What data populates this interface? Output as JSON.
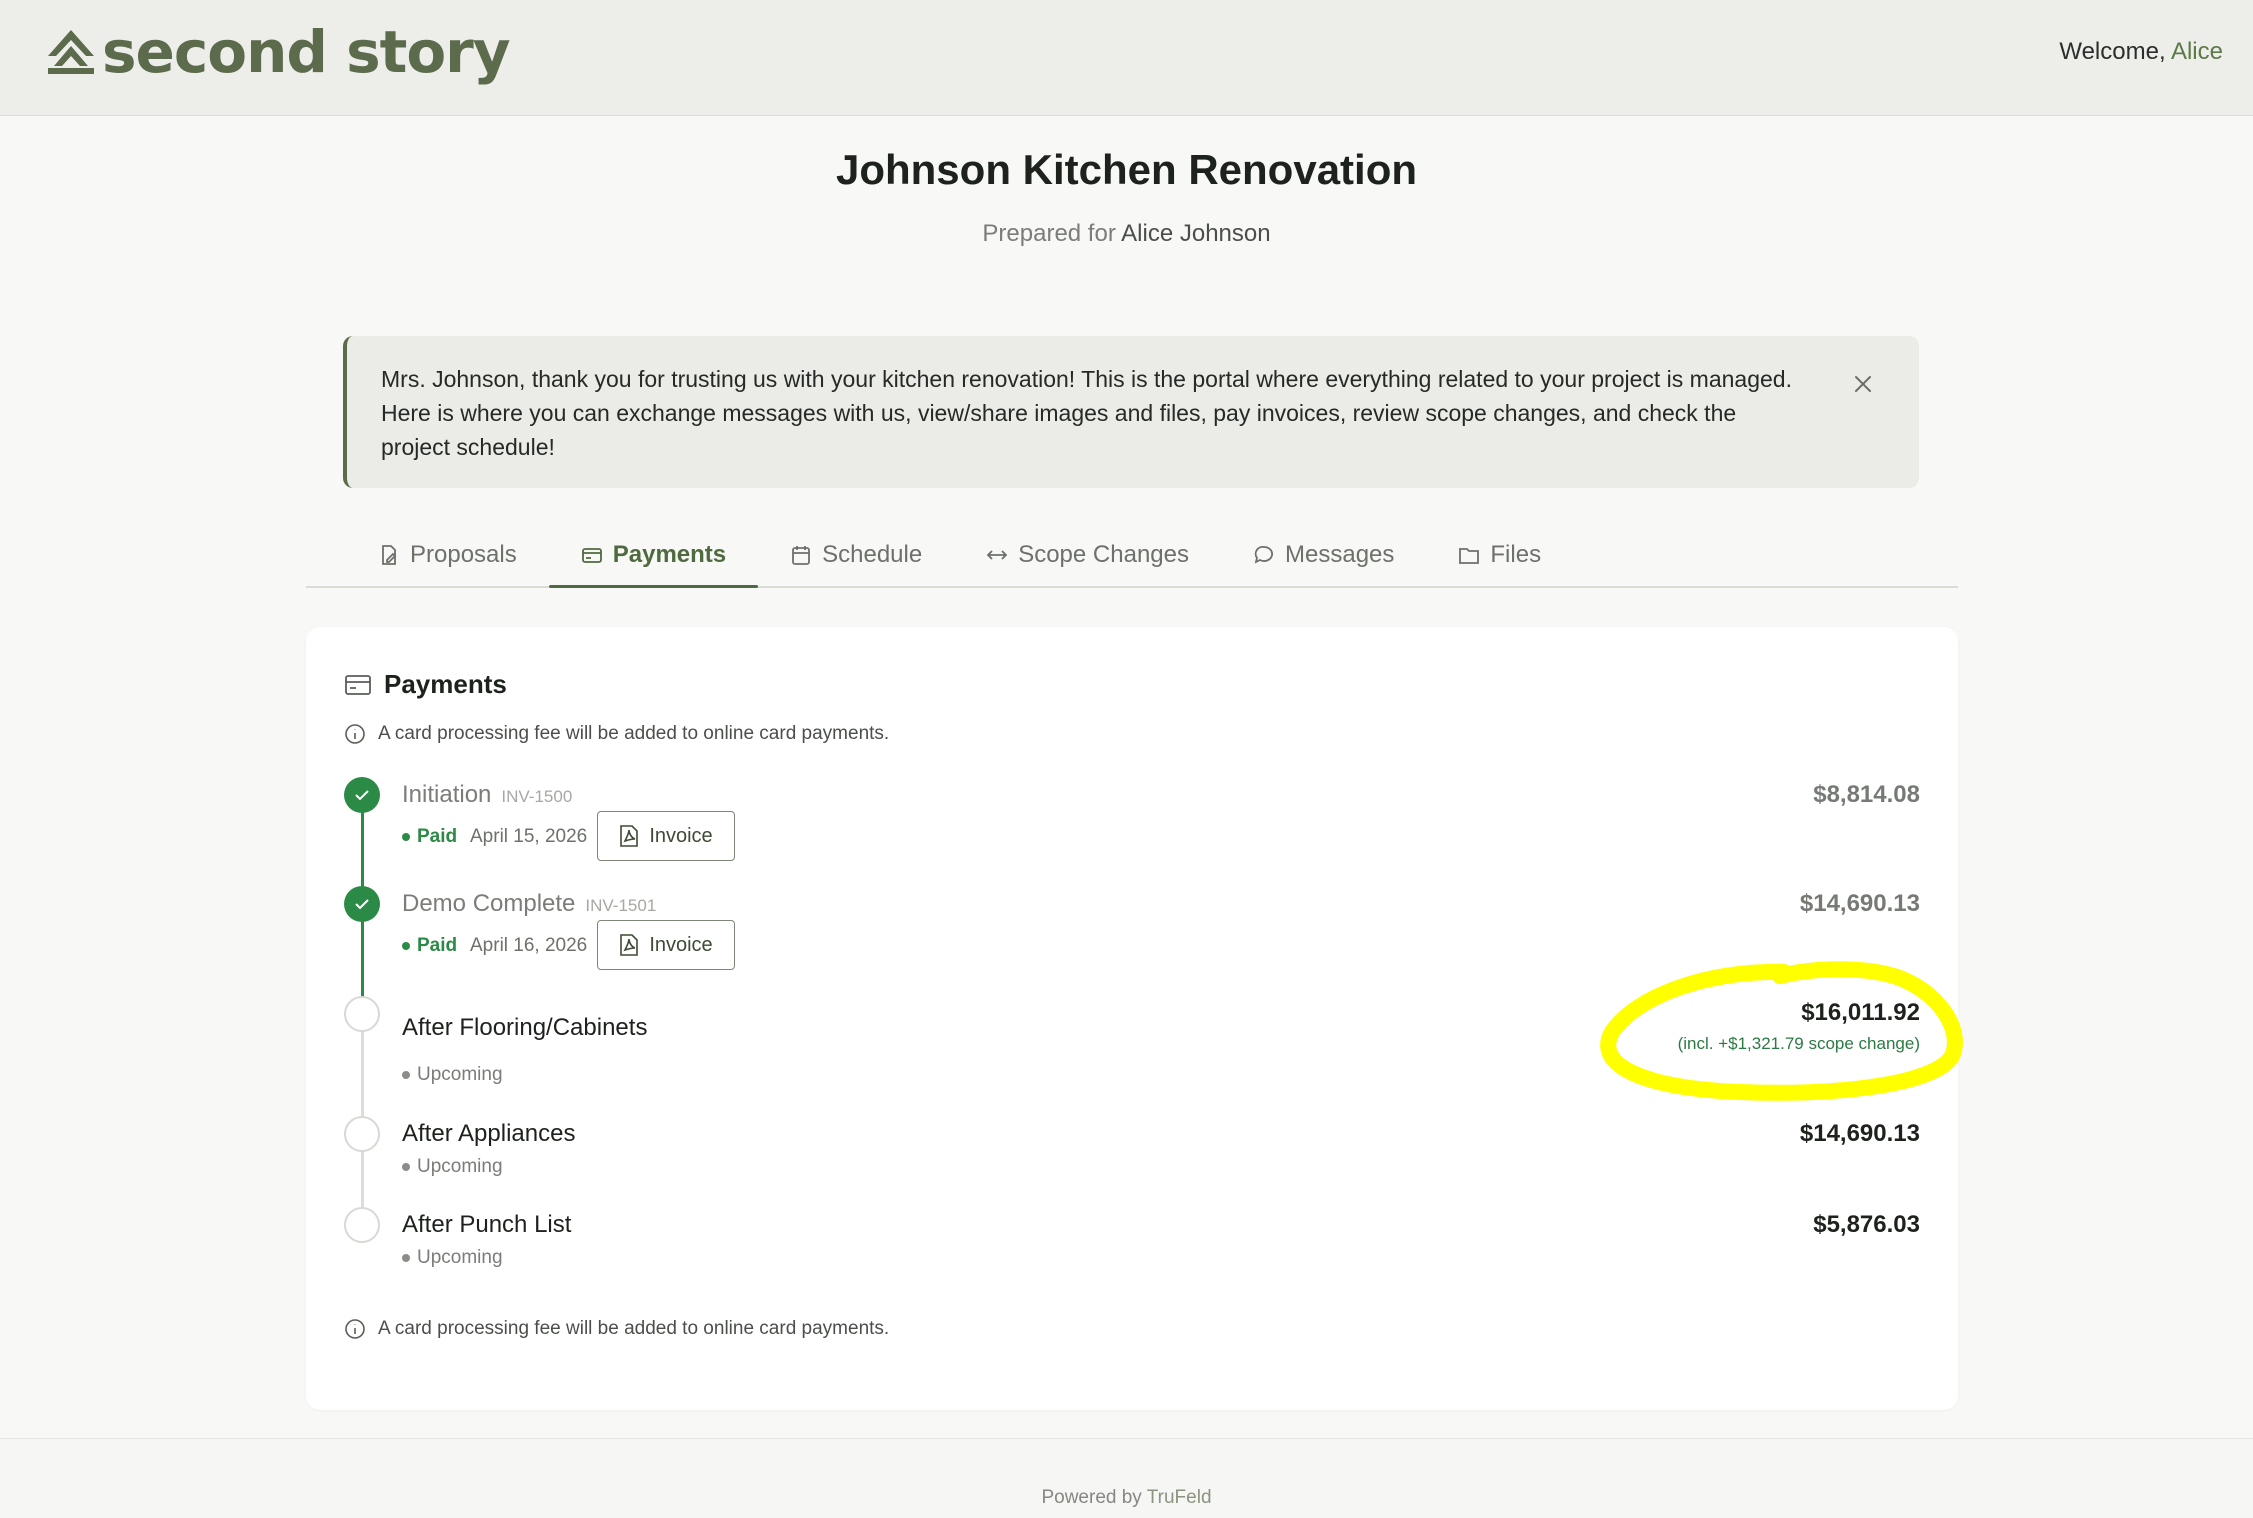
{
  "header": {
    "brand": "second story",
    "welcome_prefix": "Welcome, ",
    "user_name": "Alice"
  },
  "project": {
    "title": "Johnson Kitchen Renovation",
    "prepared_prefix": "Prepared for ",
    "client_name": "Alice Johnson"
  },
  "notice": {
    "text": "Mrs. Johnson, thank you for trusting us with your kitchen renovation! This is the portal where everything related to your project is managed. Here is where you can exchange messages with us, view/share images and files, pay invoices, review scope changes, and check the project schedule!"
  },
  "tabs": [
    {
      "label": "Proposals",
      "icon": "proposal-icon"
    },
    {
      "label": "Payments",
      "icon": "credit-card-icon",
      "active": true
    },
    {
      "label": "Schedule",
      "icon": "calendar-icon"
    },
    {
      "label": "Scope Changes",
      "icon": "arrows-horizontal-icon"
    },
    {
      "label": "Messages",
      "icon": "message-icon"
    },
    {
      "label": "Files",
      "icon": "folder-icon"
    }
  ],
  "payments": {
    "title": "Payments",
    "fee_note": "A card processing fee will be added to online card payments.",
    "invoice_label": "Invoice",
    "items": [
      {
        "name": "Initiation",
        "code": "INV-1500",
        "status": "Paid",
        "date": "April 15, 2026",
        "amount": "$8,814.08"
      },
      {
        "name": "Demo Complete",
        "code": "INV-1501",
        "status": "Paid",
        "date": "April 16, 2026",
        "amount": "$14,690.13"
      },
      {
        "name": "After Flooring/Cabinets",
        "status": "Upcoming",
        "amount": "$16,011.92",
        "scope_note": "(incl. +$1,321.79 scope change)"
      },
      {
        "name": "After Appliances",
        "status": "Upcoming",
        "amount": "$14,690.13"
      },
      {
        "name": "After Punch List",
        "status": "Upcoming",
        "amount": "$5,876.03"
      }
    ]
  },
  "footer": {
    "prefix": "Powered by ",
    "brand": "TruFeld"
  },
  "colors": {
    "brand": "#5b6b4b",
    "paid_green": "#2c8a47",
    "highlight": "#ffff00"
  }
}
